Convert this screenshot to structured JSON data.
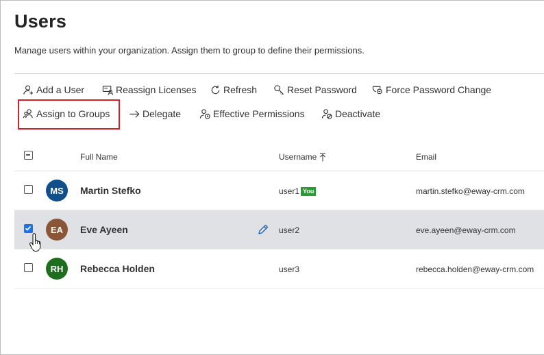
{
  "page": {
    "title": "Users",
    "description": "Manage users within your organization. Assign them to group to define their permissions."
  },
  "toolbar": {
    "row1": [
      {
        "label": "Add a User",
        "icon": "add-user-icon"
      },
      {
        "label": "Reassign Licenses",
        "icon": "reassign-licenses-icon"
      },
      {
        "label": "Refresh",
        "icon": "refresh-icon"
      },
      {
        "label": "Reset Password",
        "icon": "key-icon"
      },
      {
        "label": "Force Password Change",
        "icon": "shield-key-icon"
      }
    ],
    "row2": [
      {
        "label": "Assign to Groups",
        "icon": "group-icon"
      },
      {
        "label": "Delegate",
        "icon": "arrow-right-icon"
      },
      {
        "label": "Effective Permissions",
        "icon": "permissions-icon"
      },
      {
        "label": "Deactivate",
        "icon": "deactivate-icon"
      }
    ]
  },
  "table": {
    "headers": {
      "full_name": "Full Name",
      "username": "Username",
      "email": "Email"
    },
    "rows": [
      {
        "initials": "MS",
        "avatar_color": "#0e4f8c",
        "name": "Martin Stefko",
        "username": "user1",
        "badge": "You",
        "email": "martin.stefko@eway-crm.com",
        "checked": false
      },
      {
        "initials": "EA",
        "avatar_color": "#8a5637",
        "name": "Eve Ayeen",
        "username": "user2",
        "email": "eve.ayeen@eway-crm.com",
        "checked": true
      },
      {
        "initials": "RH",
        "avatar_color": "#1d6f1d",
        "name": "Rebecca Holden",
        "username": "user3",
        "email": "rebecca.holden@eway-crm.com",
        "checked": false
      }
    ]
  },
  "colors": {
    "highlight_border": "#d61f26",
    "selected_row": "#dfe1e5",
    "checkbox_checked": "#1a73e8",
    "you_badge": "#2b9a36"
  }
}
